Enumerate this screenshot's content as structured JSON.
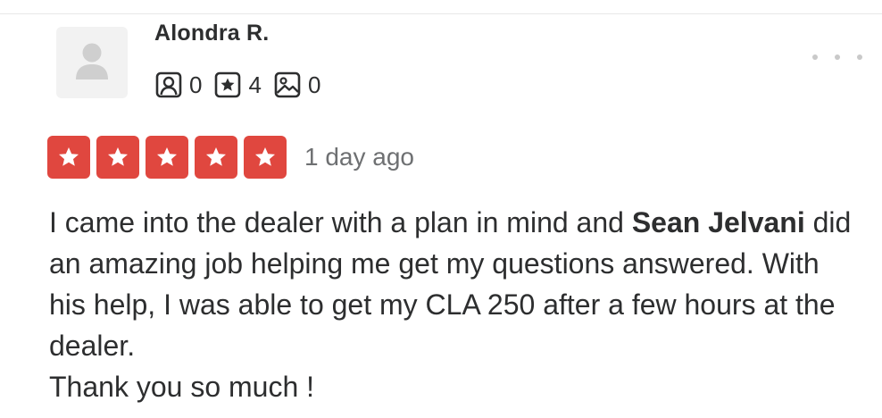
{
  "review": {
    "user": {
      "name": "Alondra R.",
      "stats": {
        "friends": "0",
        "reviews": "4",
        "photos": "0"
      }
    },
    "rating": 5,
    "rating_max": 5,
    "date": "1 day ago",
    "text": {
      "part1": "I came into the dealer with a plan in mind and ",
      "bold_name": "Sean Jelvani",
      "part2": " did an amazing job helping me get my questions answered. With his help, I was able to get my CLA 250 after a few hours at the dealer.",
      "part3": "Thank you so much !"
    }
  },
  "icons": {
    "avatar": "default-user-avatar",
    "friends": "friends-icon",
    "reviews": "review-star-icon",
    "photos": "photo-icon",
    "menu": "more-options-icon",
    "star": "star-icon"
  },
  "colors": {
    "star_fill": "#e0473f",
    "text": "#2d2e2f",
    "muted": "#6e7072",
    "avatar_bg": "#f2f2f2"
  }
}
